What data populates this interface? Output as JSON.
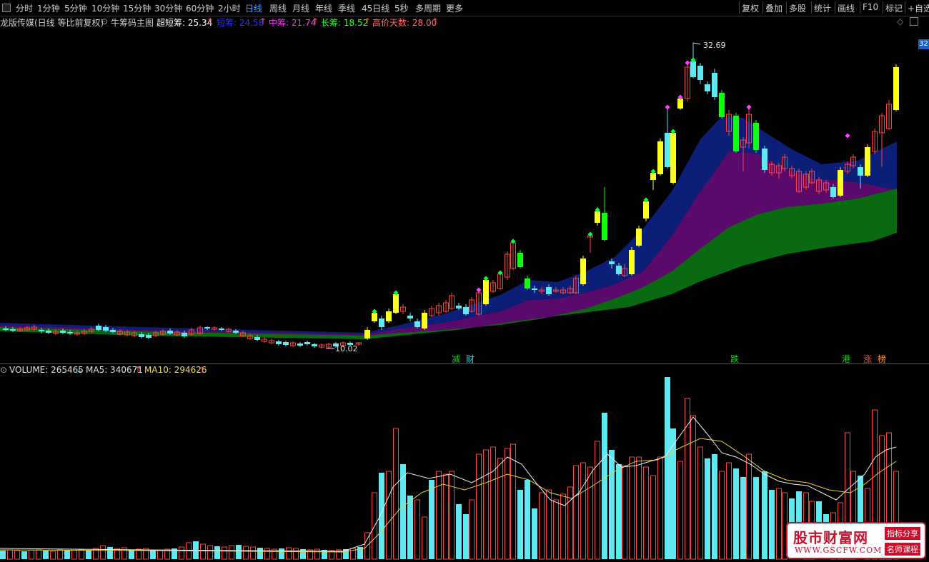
{
  "toolbar": {
    "periods": [
      "分时",
      "1分钟",
      "5分钟",
      "10分钟",
      "15分钟",
      "30分钟",
      "60分钟",
      "2小时",
      "日线",
      "周线",
      "月线",
      "年线",
      "季线",
      "45日线",
      "5秒",
      "多周期",
      "更多"
    ],
    "active": "日线",
    "right_items": [
      "复权",
      "叠加",
      "多股",
      "统计",
      "画线",
      "F10",
      "标记",
      "+自选"
    ]
  },
  "main_header": {
    "stock": "龙版传媒(日线 等比前复权)",
    "indicator": "牛筹码主图",
    "super_short_label": "超短筹: 25.34",
    "short_label": "短筹: 24.58",
    "mid_label": "中筹: 21.74",
    "long_label": "长筹: 18.52",
    "days_label": "高价天数: 28.00",
    "arrow": "↑"
  },
  "price_tag": "32",
  "annotations": {
    "high": "32.69",
    "low": "10.02"
  },
  "event_marks": [
    {
      "text": "减",
      "color": "#00e000"
    },
    {
      "text": "财",
      "color": "#00e0e0"
    },
    {
      "text": "跌",
      "color": "#00e000"
    },
    {
      "text": "港",
      "color": "#00e000"
    },
    {
      "text": "涨",
      "color": "#ff4040"
    },
    {
      "text": "榜",
      "color": "#ff9020"
    }
  ],
  "volume_header": {
    "volume_label": "VOLUME: 265465",
    "volume_arrow": "↓",
    "ma5_label": "MA5: 340671",
    "ma5_arrow": "↑",
    "ma10_label": "MA10: 294626",
    "ma10_arrow": "↑"
  },
  "watermark": {
    "title": "股市财富网",
    "url": "WWW.GSCFW.COM",
    "tag1": "指标分享",
    "tag2": "名师课程"
  },
  "colors": {
    "up": "#ff4040",
    "down": "#60e8f0",
    "yellow": "#ffff20",
    "green_bar": "#10ff10",
    "band_blue": "#0b1e78",
    "band_purple": "#5a0a6a",
    "band_green": "#0a6a12"
  }
}
